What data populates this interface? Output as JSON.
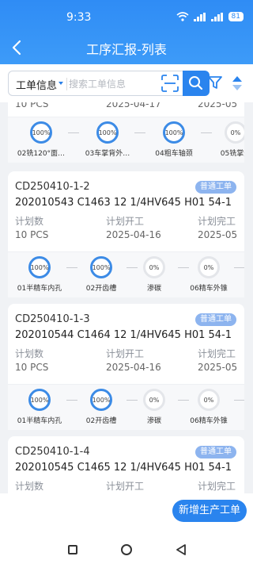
{
  "status": {
    "time": "9:33",
    "battery": "81"
  },
  "nav": {
    "title": "工序汇报-列表"
  },
  "search": {
    "field_label": "工单信息",
    "placeholder": "搜索工单信息"
  },
  "actions": {
    "add_label": "新增生产工单"
  },
  "list": {
    "partial_top": {
      "values": [
        "10 PCS",
        "2025-04-17",
        "2025-05"
      ],
      "steps": [
        {
          "pct": "100%",
          "name": "02铣120°面…"
        },
        {
          "pct": "100%",
          "name": "03车掌背外…"
        },
        {
          "pct": "100%",
          "name": "04粗车轴颈"
        },
        {
          "pct": "0%",
          "name": "05铣掌外"
        }
      ]
    },
    "cards": [
      {
        "code": "CD250410-1-2",
        "badge": "普通工单",
        "material": "202010543 C1463 12 1/4HV645 H01 54-1",
        "labels": [
          "计划数",
          "计划开工",
          "计划完工"
        ],
        "values": [
          "10 PCS",
          "2025-04-16",
          "2025-05"
        ],
        "steps": [
          {
            "pct": "100%",
            "name": "01半精车内孔"
          },
          {
            "pct": "100%",
            "name": "02开齿槽"
          },
          {
            "pct": "0%",
            "name": "渗碳"
          },
          {
            "pct": "0%",
            "name": "06精车外锥"
          }
        ]
      },
      {
        "code": "CD250410-1-3",
        "badge": "普通工单",
        "material": "202010544 C1464 12 1/4HV645 H01 54-1",
        "labels": [
          "计划数",
          "计划开工",
          "计划完工"
        ],
        "values": [
          "10 PCS",
          "2025-04-16",
          "2025-05"
        ],
        "steps": [
          {
            "pct": "100%",
            "name": "01半精车内孔"
          },
          {
            "pct": "100%",
            "name": "02开齿槽"
          },
          {
            "pct": "0%",
            "name": "渗碳"
          },
          {
            "pct": "0%",
            "name": "06精车外锥"
          }
        ]
      },
      {
        "code": "CD250410-1-4",
        "badge": "普通工单",
        "material": "202010545 C1465 12 1/4HV645 H01 54-1",
        "labels": [
          "计划数",
          "计划开工",
          "计划完工"
        ]
      }
    ]
  }
}
